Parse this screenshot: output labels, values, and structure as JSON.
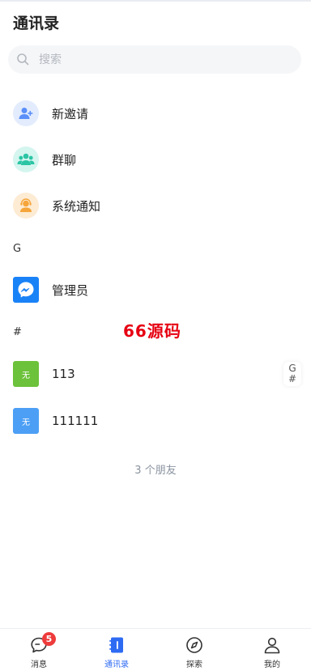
{
  "header": {
    "title": "通讯录"
  },
  "search": {
    "placeholder": "搜索",
    "value": ""
  },
  "system_items": [
    {
      "label": "新邀请",
      "icon": "add-user-icon",
      "bg": "#e3ecfd",
      "fg": "#5b8ff9"
    },
    {
      "label": "群聊",
      "icon": "group-icon",
      "bg": "#d5f5ef",
      "fg": "#2bc5a5"
    },
    {
      "label": "系统通知",
      "icon": "service-icon",
      "bg": "#fdebd3",
      "fg": "#f5a53a"
    }
  ],
  "sections": [
    {
      "letter": "G",
      "contacts": [
        {
          "name": "管理员",
          "avatar_text": "",
          "avatar_icon": "messenger-icon",
          "color": "#1a82f7"
        }
      ]
    },
    {
      "letter": "#",
      "contacts": [
        {
          "name": "113",
          "avatar_text": "无",
          "color": "#6cc23a"
        },
        {
          "name": "111111",
          "avatar_text": "无",
          "color": "#4c9ff5"
        }
      ]
    }
  ],
  "index_letters": [
    "G",
    "#"
  ],
  "friend_count_text": "3 个朋友",
  "watermark": "66源码",
  "tabs": [
    {
      "label": "消息",
      "icon": "chat-icon",
      "badge": "5",
      "active": false
    },
    {
      "label": "通讯录",
      "icon": "contacts-icon",
      "active": true
    },
    {
      "label": "探索",
      "icon": "compass-icon",
      "active": false
    },
    {
      "label": "我的",
      "icon": "profile-icon",
      "active": false
    }
  ],
  "colors": {
    "accent": "#2e6bf3",
    "badge": "#ee3b3b",
    "watermark": "#e60012"
  }
}
